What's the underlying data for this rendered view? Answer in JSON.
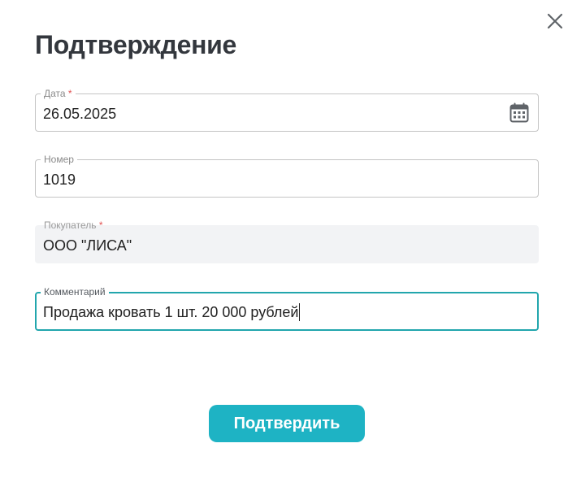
{
  "dialog": {
    "title": "Подтверждение",
    "close_icon": "close-icon"
  },
  "fields": {
    "date": {
      "label": "Дата",
      "required_mark": "*",
      "value": "26.05.2025",
      "icon": "calendar-icon"
    },
    "number": {
      "label": "Номер",
      "value": "1019"
    },
    "buyer": {
      "label": "Покупатель",
      "required_mark": "*",
      "value": "ООО \"ЛИСА\""
    },
    "comment": {
      "label": "Комментарий",
      "value": "Продажа кровать 1 шт. 20 000 рублей"
    }
  },
  "actions": {
    "confirm_label": "Подтвердить"
  },
  "colors": {
    "title": "#33373d",
    "accent": "#1eb3c4",
    "focus_border": "#22a6ad",
    "required": "#e05050",
    "disabled_bg": "#f2f3f5"
  }
}
